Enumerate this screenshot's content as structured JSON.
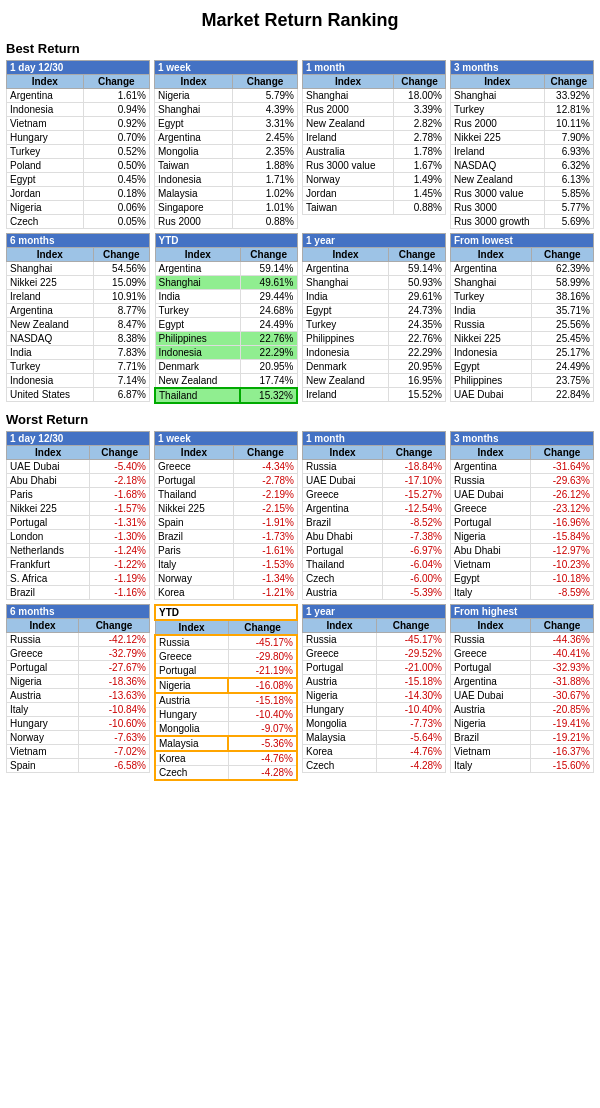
{
  "title": "Market Return Ranking",
  "best": {
    "label": "Best Return",
    "rows": [
      {
        "period": "1 day 12/30",
        "highlight": "none",
        "headers": [
          "Index",
          "Change"
        ],
        "data": [
          [
            "Argentina",
            "1.61%"
          ],
          [
            "Indonesia",
            "0.94%"
          ],
          [
            "Vietnam",
            "0.92%"
          ],
          [
            "Hungary",
            "0.70%"
          ],
          [
            "Turkey",
            "0.52%"
          ],
          [
            "Poland",
            "0.50%"
          ],
          [
            "Egypt",
            "0.45%"
          ],
          [
            "Jordan",
            "0.18%"
          ],
          [
            "Nigeria",
            "0.06%"
          ],
          [
            "Czech",
            "0.05%"
          ]
        ]
      },
      {
        "period": "1 week",
        "highlight": "none",
        "headers": [
          "Index",
          "Change"
        ],
        "data": [
          [
            "Nigeria",
            "5.79%"
          ],
          [
            "Shanghai",
            "4.39%"
          ],
          [
            "Egypt",
            "3.31%"
          ],
          [
            "Argentina",
            "2.45%"
          ],
          [
            "Mongolia",
            "2.35%"
          ],
          [
            "Taiwan",
            "1.88%"
          ],
          [
            "Indonesia",
            "1.71%"
          ],
          [
            "Malaysia",
            "1.02%"
          ],
          [
            "Singapore",
            "1.01%"
          ],
          [
            "Rus 2000",
            "0.88%"
          ]
        ]
      },
      {
        "period": "1 month",
        "highlight": "none",
        "headers": [
          "Index",
          "Change"
        ],
        "data": [
          [
            "Shanghai",
            "18.00%"
          ],
          [
            "Rus 2000",
            "3.39%"
          ],
          [
            "New Zealand",
            "2.82%"
          ],
          [
            "Ireland",
            "2.78%"
          ],
          [
            "Australia",
            "1.78%"
          ],
          [
            "Rus 3000 value",
            "1.67%"
          ],
          [
            "Norway",
            "1.49%"
          ],
          [
            "Jordan",
            "1.45%"
          ],
          [
            "Taiwan",
            "0.88%"
          ]
        ]
      },
      {
        "period": "3 months",
        "highlight": "none",
        "headers": [
          "Index",
          "Change"
        ],
        "data": [
          [
            "Shanghai",
            "33.92%"
          ],
          [
            "Turkey",
            "12.81%"
          ],
          [
            "Rus 2000",
            "10.11%"
          ],
          [
            "Nikkei 225",
            "7.90%"
          ],
          [
            "Ireland",
            "6.93%"
          ],
          [
            "NASDAQ",
            "6.32%"
          ],
          [
            "New Zealand",
            "6.13%"
          ],
          [
            "Rus 3000 value",
            "5.85%"
          ],
          [
            "Rus 3000",
            "5.77%"
          ],
          [
            "Rus 3000 growth",
            "5.69%"
          ]
        ]
      }
    ]
  },
  "best2": {
    "rows": [
      {
        "period": "6 months",
        "highlight": "none",
        "headers": [
          "Index",
          "Change"
        ],
        "data": [
          [
            "Shanghai",
            "54.56%"
          ],
          [
            "Nikkei 225",
            "15.09%"
          ],
          [
            "Ireland",
            "10.91%"
          ],
          [
            "Argentina",
            "8.77%"
          ],
          [
            "New Zealand",
            "8.47%"
          ],
          [
            "NASDAQ",
            "8.38%"
          ],
          [
            "India",
            "7.83%"
          ],
          [
            "Turkey",
            "7.71%"
          ],
          [
            "Indonesia",
            "7.14%"
          ],
          [
            "United States",
            "6.87%"
          ]
        ]
      },
      {
        "period": "YTD",
        "highlight": "green",
        "headers": [
          "Index",
          "Change"
        ],
        "data": [
          [
            "Argentina",
            "59.14%",
            "none"
          ],
          [
            "Shanghai",
            "49.61%",
            "green"
          ],
          [
            "India",
            "29.44%",
            "none"
          ],
          [
            "Turkey",
            "24.68%",
            "none"
          ],
          [
            "Egypt",
            "24.49%",
            "none"
          ],
          [
            "Philippines",
            "22.76%",
            "green"
          ],
          [
            "Indonesia",
            "22.29%",
            "green"
          ],
          [
            "Denmark",
            "20.95%",
            "none"
          ],
          [
            "New Zealand",
            "17.74%",
            "none"
          ],
          [
            "Thailand",
            "15.32%",
            "green-border"
          ]
        ]
      },
      {
        "period": "1 year",
        "highlight": "none",
        "headers": [
          "Index",
          "Change"
        ],
        "data": [
          [
            "Argentina",
            "59.14%"
          ],
          [
            "Shanghai",
            "50.93%"
          ],
          [
            "India",
            "29.61%"
          ],
          [
            "Egypt",
            "24.73%"
          ],
          [
            "Turkey",
            "24.35%"
          ],
          [
            "Philippines",
            "22.76%"
          ],
          [
            "Indonesia",
            "22.29%"
          ],
          [
            "Denmark",
            "20.95%"
          ],
          [
            "New Zealand",
            "16.95%"
          ],
          [
            "Ireland",
            "15.52%"
          ]
        ]
      },
      {
        "period": "From lowest",
        "highlight": "none",
        "headers": [
          "Index",
          "Change"
        ],
        "data": [
          [
            "Argentina",
            "62.39%"
          ],
          [
            "Shanghai",
            "58.99%"
          ],
          [
            "Turkey",
            "38.16%"
          ],
          [
            "India",
            "35.71%"
          ],
          [
            "Russia",
            "25.56%"
          ],
          [
            "Nikkei 225",
            "25.45%"
          ],
          [
            "Indonesia",
            "25.17%"
          ],
          [
            "Egypt",
            "24.49%"
          ],
          [
            "Philippines",
            "23.75%"
          ],
          [
            "UAE Dubai",
            "22.84%"
          ]
        ]
      }
    ]
  },
  "worst": {
    "label": "Worst Return",
    "rows": [
      {
        "period": "1 day 12/30",
        "highlight": "none",
        "headers": [
          "Index",
          "Change"
        ],
        "data": [
          [
            "UAE Dubai",
            "-5.40%"
          ],
          [
            "Abu Dhabi",
            "-2.18%"
          ],
          [
            "Paris",
            "-1.68%"
          ],
          [
            "Nikkei 225",
            "-1.57%"
          ],
          [
            "Portugal",
            "-1.31%"
          ],
          [
            "London",
            "-1.30%"
          ],
          [
            "Netherlands",
            "-1.24%"
          ],
          [
            "Frankfurt",
            "-1.22%"
          ],
          [
            "S. Africa",
            "-1.19%"
          ],
          [
            "Brazil",
            "-1.16%"
          ]
        ]
      },
      {
        "period": "1 week",
        "highlight": "none",
        "headers": [
          "Index",
          "Change"
        ],
        "data": [
          [
            "Greece",
            "-4.34%"
          ],
          [
            "Portugal",
            "-2.78%"
          ],
          [
            "Thailand",
            "-2.19%"
          ],
          [
            "Nikkei 225",
            "-2.15%"
          ],
          [
            "Spain",
            "-1.91%"
          ],
          [
            "Brazil",
            "-1.73%"
          ],
          [
            "Paris",
            "-1.61%"
          ],
          [
            "Italy",
            "-1.53%"
          ],
          [
            "Norway",
            "-1.34%"
          ],
          [
            "Korea",
            "-1.21%"
          ]
        ]
      },
      {
        "period": "1 month",
        "highlight": "none",
        "headers": [
          "Index",
          "Change"
        ],
        "data": [
          [
            "Russia",
            "-18.84%"
          ],
          [
            "UAE Dubai",
            "-17.10%"
          ],
          [
            "Greece",
            "-15.27%"
          ],
          [
            "Argentina",
            "-12.54%"
          ],
          [
            "Brazil",
            "-8.52%"
          ],
          [
            "Abu Dhabi",
            "-7.38%"
          ],
          [
            "Portugal",
            "-6.97%"
          ],
          [
            "Thailand",
            "-6.04%"
          ],
          [
            "Czech",
            "-6.00%"
          ],
          [
            "Austria",
            "-5.39%"
          ]
        ]
      },
      {
        "period": "3 months",
        "highlight": "none",
        "headers": [
          "Index",
          "Change"
        ],
        "data": [
          [
            "Argentina",
            "-31.64%"
          ],
          [
            "Russia",
            "-29.63%"
          ],
          [
            "UAE Dubai",
            "-26.12%"
          ],
          [
            "Greece",
            "-23.12%"
          ],
          [
            "Portugal",
            "-16.96%"
          ],
          [
            "Nigeria",
            "-15.84%"
          ],
          [
            "Abu Dhabi",
            "-12.97%"
          ],
          [
            "Vietnam",
            "-10.23%"
          ],
          [
            "Egypt",
            "-10.18%"
          ],
          [
            "Italy",
            "-8.59%"
          ]
        ]
      }
    ]
  },
  "worst2": {
    "rows": [
      {
        "period": "6 months",
        "highlight": "none",
        "headers": [
          "Index",
          "Change"
        ],
        "data": [
          [
            "Russia",
            "-42.12%"
          ],
          [
            "Greece",
            "-32.79%"
          ],
          [
            "Portugal",
            "-27.67%"
          ],
          [
            "Nigeria",
            "-18.36%"
          ],
          [
            "Austria",
            "-13.63%"
          ],
          [
            "Italy",
            "-10.84%"
          ],
          [
            "Hungary",
            "-10.60%"
          ],
          [
            "Norway",
            "-7.63%"
          ],
          [
            "Vietnam",
            "-7.02%"
          ],
          [
            "Spain",
            "-6.58%"
          ]
        ]
      },
      {
        "period": "YTD",
        "highlight": "orange",
        "headers": [
          "Index",
          "Change"
        ],
        "data": [
          [
            "Russia",
            "-45.17%",
            "none"
          ],
          [
            "Greece",
            "-29.80%",
            "none"
          ],
          [
            "Portugal",
            "-21.19%",
            "none"
          ],
          [
            "Nigeria",
            "-16.08%",
            "orange"
          ],
          [
            "Austria",
            "-15.18%",
            "none"
          ],
          [
            "Hungary",
            "-10.40%",
            "none"
          ],
          [
            "Mongolia",
            "-9.07%",
            "none"
          ],
          [
            "Malaysia",
            "-5.36%",
            "orange"
          ],
          [
            "Korea",
            "-4.76%",
            "none"
          ],
          [
            "Czech",
            "-4.28%",
            "none"
          ]
        ]
      },
      {
        "period": "1 year",
        "highlight": "none",
        "headers": [
          "Index",
          "Change"
        ],
        "data": [
          [
            "Russia",
            "-45.17%"
          ],
          [
            "Greece",
            "-29.52%"
          ],
          [
            "Portugal",
            "-21.00%"
          ],
          [
            "Austria",
            "-15.18%"
          ],
          [
            "Nigeria",
            "-14.30%"
          ],
          [
            "Hungary",
            "-10.40%"
          ],
          [
            "Mongolia",
            "-7.73%"
          ],
          [
            "Malaysia",
            "-5.64%"
          ],
          [
            "Korea",
            "-4.76%"
          ],
          [
            "Czech",
            "-4.28%"
          ]
        ]
      },
      {
        "period": "From highest",
        "highlight": "none",
        "headers": [
          "Index",
          "Change"
        ],
        "data": [
          [
            "Russia",
            "-44.36%"
          ],
          [
            "Greece",
            "-40.41%"
          ],
          [
            "Portugal",
            "-32.93%"
          ],
          [
            "Argentina",
            "-31.88%"
          ],
          [
            "UAE Dubai",
            "-30.67%"
          ],
          [
            "Austria",
            "-20.85%"
          ],
          [
            "Nigeria",
            "-19.41%"
          ],
          [
            "Brazil",
            "-19.21%"
          ],
          [
            "Vietnam",
            "-16.37%"
          ],
          [
            "Italy",
            "-15.60%"
          ]
        ]
      }
    ]
  }
}
